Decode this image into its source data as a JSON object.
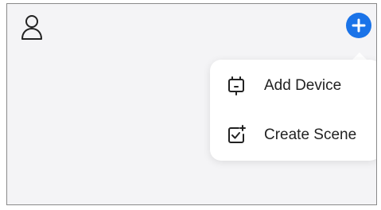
{
  "header": {
    "profile_icon": "person-outline-icon",
    "add_icon": "plus-circle-icon",
    "accent_color": "#1a73e8"
  },
  "menu": {
    "items": [
      {
        "label": "Add Device",
        "icon": "device-icon"
      },
      {
        "label": "Create Scene",
        "icon": "create-scene-icon"
      }
    ]
  }
}
